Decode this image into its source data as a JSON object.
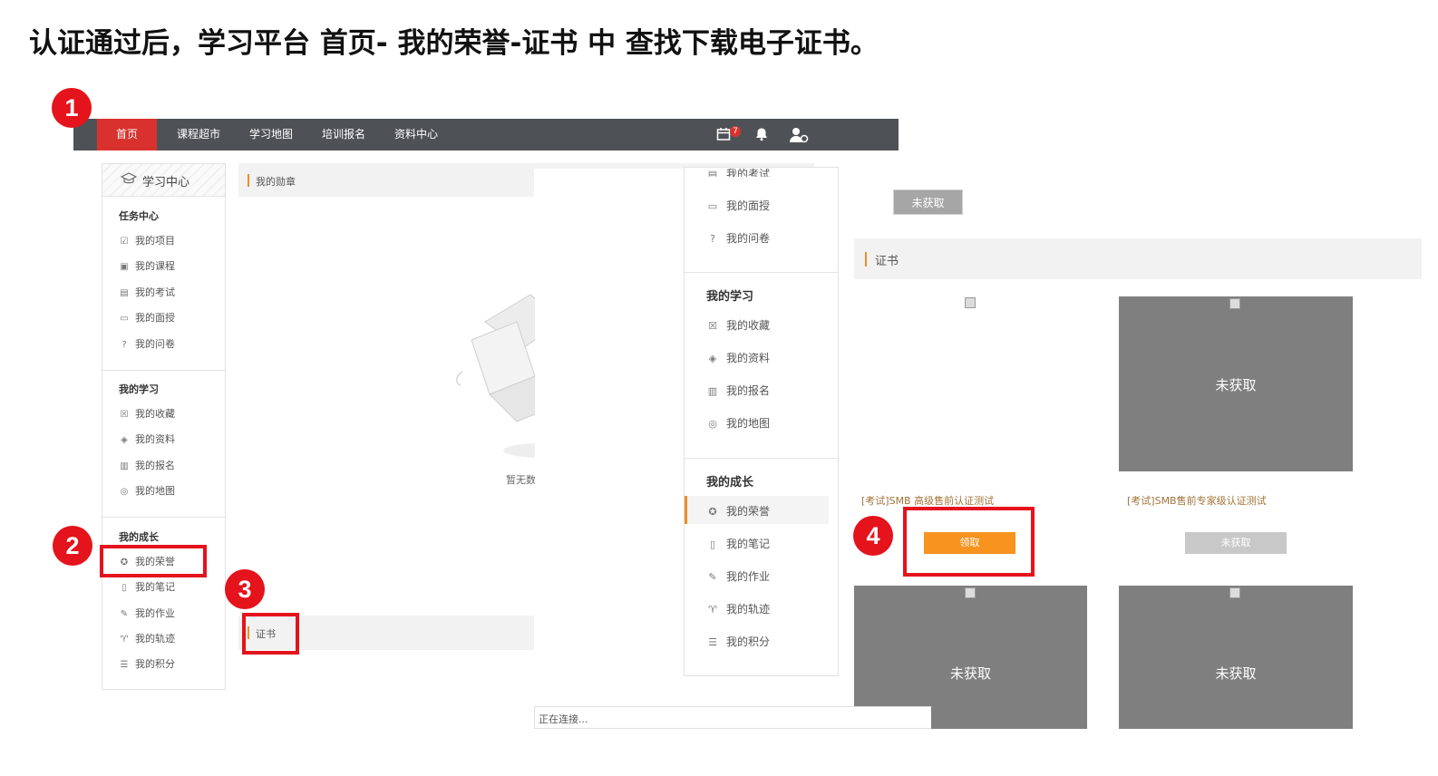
{
  "slide_title": "认证通过后，学习平台 首页- 我的荣誉-证书 中 查找下载电子证书。",
  "markers": [
    "1",
    "2",
    "3",
    "4"
  ],
  "nav": {
    "items": [
      "首页",
      "课程超市",
      "学习地图",
      "培训报名",
      "资料中心"
    ],
    "badge": "7",
    "icons": [
      "calendar-icon",
      "bell-icon",
      "user-icon"
    ]
  },
  "left_sidebar": {
    "title": "学习中心",
    "sections": [
      {
        "title": "任务中心",
        "items": [
          "我的项目",
          "我的课程",
          "我的考试",
          "我的面授",
          "我的问卷"
        ]
      },
      {
        "title": "我的学习",
        "items": [
          "我的收藏",
          "我的资料",
          "我的报名",
          "我的地图"
        ]
      },
      {
        "title": "我的成长",
        "items": [
          "我的荣誉",
          "我的笔记",
          "我的作业",
          "我的轨迹",
          "我的积分"
        ]
      }
    ]
  },
  "middle": {
    "medal_tab": "我的勋章",
    "empty_text": "暂无数",
    "cert_tab": "证书"
  },
  "right_sidebar": {
    "top_items": [
      "我的考试",
      "我的面授",
      "我的问卷"
    ],
    "sections": [
      {
        "title": "我的学习",
        "items": [
          "我的收藏",
          "我的资料",
          "我的报名",
          "我的地图"
        ]
      },
      {
        "title": "我的成长",
        "items": [
          "我的荣誉",
          "我的笔记",
          "我的作业",
          "我的轨迹",
          "我的积分"
        ]
      }
    ]
  },
  "cert_panel": {
    "top_button": "未获取",
    "section_title": "证书",
    "cards": [
      {
        "status": "",
        "caption": "[考试]SMB 高级售前认证测试",
        "button": "领取"
      },
      {
        "status": "未获取",
        "caption": "[考试]SMB售前专家级认证测试",
        "button": "未获取"
      },
      {
        "status": "未获取"
      },
      {
        "status": "未获取"
      }
    ]
  },
  "status_bar": "正在连接...",
  "colors": {
    "nav_bg": "#4e5257",
    "nav_active": "#d9322e",
    "accent": "#f08c28",
    "marker": "#e4131c",
    "claim_button": "#f7931e"
  }
}
